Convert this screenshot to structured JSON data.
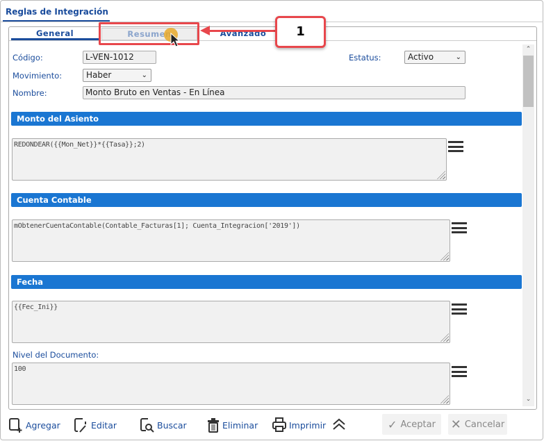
{
  "window": {
    "tab_title": "Reglas de Integración"
  },
  "tabs": [
    {
      "label": "General"
    },
    {
      "label": "Resumen"
    },
    {
      "label": "Avanzado"
    }
  ],
  "callout": {
    "number": "1"
  },
  "form": {
    "codigo_label": "Código:",
    "codigo_value": "L-VEN-1012",
    "estatus_label": "Estatus:",
    "estatus_value": "Activo",
    "movimiento_label": "Movimiento:",
    "movimiento_value": "Haber",
    "nombre_label": "Nombre:",
    "nombre_value": "Monto Bruto en Ventas - En Línea"
  },
  "sections": {
    "monto": {
      "title": "Monto del Asiento",
      "formula": "REDONDEAR({{Mon_Net}}*{{Tasa}};2)"
    },
    "cuenta": {
      "title": "Cuenta Contable",
      "formula": "mObtenerCuentaContable(Contable_Facturas[1]; Cuenta_Integracion['2019'])"
    },
    "fecha": {
      "title": "Fecha",
      "formula": "{{Fec_Ini}}"
    },
    "nivel": {
      "label": "Nivel del Documento:",
      "value": "100"
    }
  },
  "toolbar": {
    "agregar": "Agregar",
    "editar": "Editar",
    "buscar": "Buscar",
    "eliminar": "Eliminar",
    "imprimir": "Imprimir",
    "aceptar": "Aceptar",
    "cancelar": "Cancelar"
  }
}
